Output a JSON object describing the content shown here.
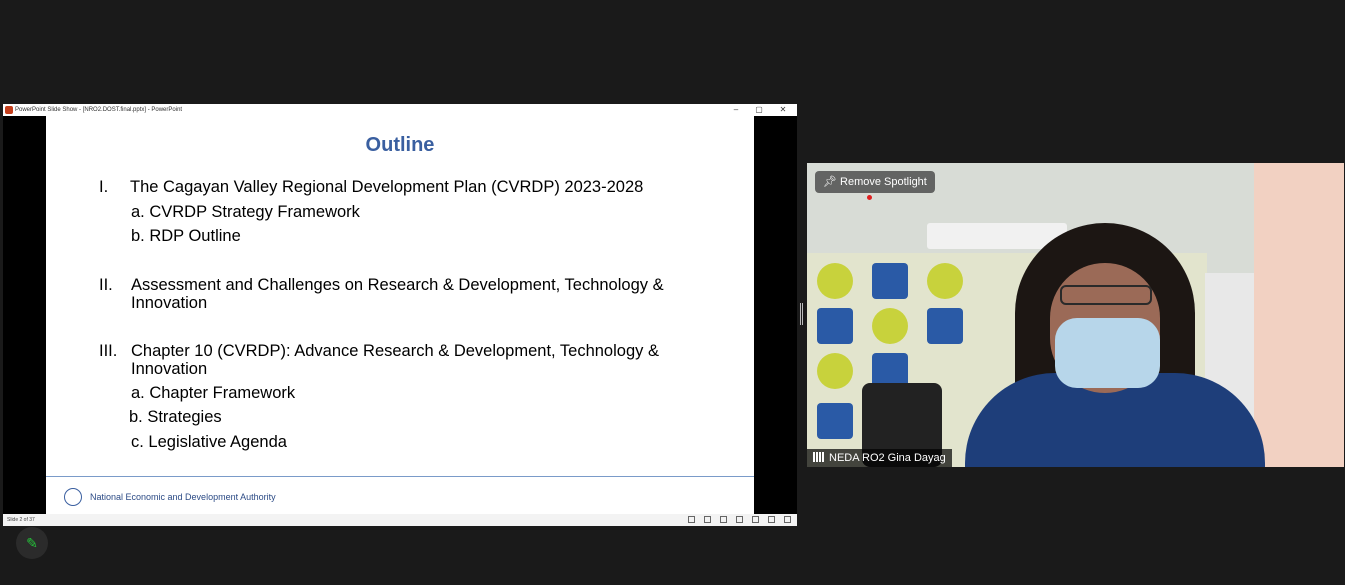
{
  "ppt_window": {
    "title": "PowerPoint Slide Show - [NRO2.DOST.final.pptx] - PowerPoint",
    "min": "–",
    "max": "▢",
    "close": "✕",
    "status_slide": "Slide 2 of 37"
  },
  "slide": {
    "title": "Outline",
    "items": [
      {
        "num": "I.",
        "text": "The Cagayan Valley Regional Development Plan (CVRDP) 2023-2028"
      },
      {
        "num": "",
        "text": "a. CVRDP Strategy Framework"
      },
      {
        "num": "",
        "text": "b.  RDP Outline"
      },
      {
        "num": "II.",
        "text": "Assessment and Challenges on Research & Development, Technology & Innovation"
      },
      {
        "num": "III.",
        "text": "Chapter 10 (CVRDP):  Advance Research & Development, Technology & Innovation"
      },
      {
        "num": "",
        "text": "a. Chapter Framework"
      },
      {
        "num": "",
        "text": "b. Strategies"
      },
      {
        "num": "",
        "text": "c. Legislative Agenda"
      }
    ],
    "footer": "National Economic and Development Authority"
  },
  "video": {
    "spotlight_label": "Remove Spotlight",
    "participant_name": "NEDA RO2 Gina Dayag"
  },
  "colors": {
    "slide_title": "#3a5fa0",
    "zoom_green": "#25c23a"
  }
}
